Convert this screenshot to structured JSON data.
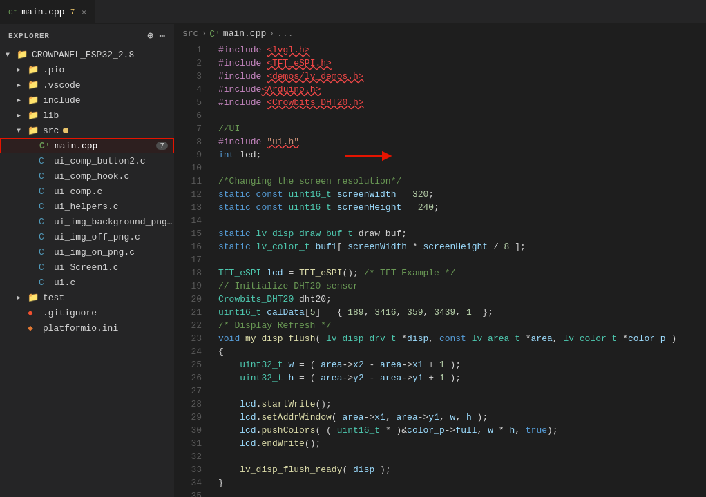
{
  "tabBar": {
    "tabs": [
      {
        "id": "main-cpp",
        "icon": "C++",
        "label": "main.cpp",
        "badge": "7",
        "active": true,
        "closable": true
      }
    ]
  },
  "sidebar": {
    "header": "EXPLORER",
    "tree": [
      {
        "id": "root",
        "label": "CROWPANEL_ESP32_2.8",
        "type": "folder",
        "open": true,
        "level": 0
      },
      {
        "id": "pio",
        "label": ".pio",
        "type": "folder",
        "open": false,
        "level": 1
      },
      {
        "id": "vscode",
        "label": ".vscode",
        "type": "folder",
        "open": false,
        "level": 1
      },
      {
        "id": "include",
        "label": "include",
        "type": "folder",
        "open": false,
        "level": 1
      },
      {
        "id": "lib",
        "label": "lib",
        "type": "folder",
        "open": false,
        "level": 1
      },
      {
        "id": "src",
        "label": "src",
        "type": "folder",
        "open": true,
        "level": 1,
        "modified": true
      },
      {
        "id": "main-cpp",
        "label": "main.cpp",
        "type": "cpp",
        "level": 2,
        "badge": "7",
        "selected": true
      },
      {
        "id": "ui_comp_button2",
        "label": "ui_comp_button2.c",
        "type": "c",
        "level": 2
      },
      {
        "id": "ui_comp_hook",
        "label": "ui_comp_hook.c",
        "type": "c",
        "level": 2
      },
      {
        "id": "ui_comp",
        "label": "ui_comp.c",
        "type": "c",
        "level": 2
      },
      {
        "id": "ui_helpers",
        "label": "ui_helpers.c",
        "type": "c",
        "level": 2
      },
      {
        "id": "ui_img_background_png",
        "label": "ui_img_background_png.c",
        "type": "c",
        "level": 2
      },
      {
        "id": "ui_img_off_png",
        "label": "ui_img_off_png.c",
        "type": "c",
        "level": 2
      },
      {
        "id": "ui_img_on_png",
        "label": "ui_img_on_png.c",
        "type": "c",
        "level": 2
      },
      {
        "id": "ui_Screen1",
        "label": "ui_Screen1.c",
        "type": "c",
        "level": 2
      },
      {
        "id": "ui",
        "label": "ui.c",
        "type": "c",
        "level": 2
      },
      {
        "id": "test",
        "label": "test",
        "type": "folder",
        "open": false,
        "level": 1
      },
      {
        "id": "gitignore",
        "label": ".gitignore",
        "type": "git",
        "level": 1
      },
      {
        "id": "platformio",
        "label": "platformio.ini",
        "type": "ini",
        "level": 1
      }
    ]
  },
  "breadcrumb": {
    "parts": [
      "src",
      ">",
      "main.cpp",
      ">",
      "..."
    ]
  },
  "editor": {
    "filename": "main.cpp",
    "lines": [
      {
        "num": 1,
        "tokens": [
          {
            "t": "#include ",
            "c": "inc"
          },
          {
            "t": "<lvgl.h>",
            "c": "str-red underline-red"
          }
        ]
      },
      {
        "num": 2,
        "tokens": [
          {
            "t": "#include ",
            "c": "inc"
          },
          {
            "t": "<TFT_eSPI.h>",
            "c": "str-red underline-red"
          }
        ]
      },
      {
        "num": 3,
        "tokens": [
          {
            "t": "#include ",
            "c": "inc"
          },
          {
            "t": "<demos/lv_demos.h>",
            "c": "str-red underline-red"
          }
        ]
      },
      {
        "num": 4,
        "tokens": [
          {
            "t": "#include",
            "c": "inc"
          },
          {
            "t": "<Arduino.h>",
            "c": "str-red underline-red"
          }
        ]
      },
      {
        "num": 5,
        "tokens": [
          {
            "t": "#include ",
            "c": "inc"
          },
          {
            "t": "<Crowbits_DHT20.h>",
            "c": "str-red underline-red"
          }
        ]
      },
      {
        "num": 6,
        "tokens": []
      },
      {
        "num": 7,
        "tokens": [
          {
            "t": "//UI",
            "c": "comment"
          }
        ]
      },
      {
        "num": 8,
        "tokens": [
          {
            "t": "#include ",
            "c": "inc"
          },
          {
            "t": "\"ui.h\"",
            "c": "str underline-red"
          }
        ]
      },
      {
        "num": 9,
        "tokens": [
          {
            "t": "int ",
            "c": "kw"
          },
          {
            "t": "led;",
            "c": "plain"
          }
        ]
      },
      {
        "num": 10,
        "tokens": []
      },
      {
        "num": 11,
        "tokens": [
          {
            "t": "/*Changing the screen resolution*/",
            "c": "comment"
          }
        ]
      },
      {
        "num": 12,
        "tokens": [
          {
            "t": "static ",
            "c": "kw"
          },
          {
            "t": "const ",
            "c": "kw"
          },
          {
            "t": "uint16_t ",
            "c": "type"
          },
          {
            "t": "screenWidth",
            "c": "var"
          },
          {
            "t": " = ",
            "c": "plain"
          },
          {
            "t": "320",
            "c": "num"
          },
          {
            "t": ";",
            "c": "punct"
          }
        ]
      },
      {
        "num": 13,
        "tokens": [
          {
            "t": "static ",
            "c": "kw"
          },
          {
            "t": "const ",
            "c": "kw"
          },
          {
            "t": "uint16_t ",
            "c": "type"
          },
          {
            "t": "screenHeight",
            "c": "var"
          },
          {
            "t": " = ",
            "c": "plain"
          },
          {
            "t": "240",
            "c": "num"
          },
          {
            "t": ";",
            "c": "punct"
          }
        ]
      },
      {
        "num": 14,
        "tokens": []
      },
      {
        "num": 15,
        "tokens": [
          {
            "t": "static ",
            "c": "kw"
          },
          {
            "t": "lv_disp_draw_buf_t ",
            "c": "type"
          },
          {
            "t": "draw_buf;",
            "c": "plain"
          }
        ]
      },
      {
        "num": 16,
        "tokens": [
          {
            "t": "static ",
            "c": "kw"
          },
          {
            "t": "lv_color_t ",
            "c": "type"
          },
          {
            "t": "buf1",
            "c": "var"
          },
          {
            "t": "[ ",
            "c": "plain"
          },
          {
            "t": "screenWidth",
            "c": "var"
          },
          {
            "t": " * ",
            "c": "plain"
          },
          {
            "t": "screenHeight",
            "c": "var"
          },
          {
            "t": " / ",
            "c": "plain"
          },
          {
            "t": "8",
            "c": "num"
          },
          {
            "t": " ];",
            "c": "plain"
          }
        ]
      },
      {
        "num": 17,
        "tokens": []
      },
      {
        "num": 18,
        "tokens": [
          {
            "t": "TFT_eSPI ",
            "c": "type"
          },
          {
            "t": "lcd",
            "c": "var"
          },
          {
            "t": " = ",
            "c": "plain"
          },
          {
            "t": "TFT_eSPI",
            "c": "fn"
          },
          {
            "t": "(); ",
            "c": "plain"
          },
          {
            "t": "/* TFT Example */",
            "c": "comment"
          }
        ]
      },
      {
        "num": 19,
        "tokens": [
          {
            "t": "// Initialize DHT20 sensor",
            "c": "comment"
          }
        ]
      },
      {
        "num": 20,
        "tokens": [
          {
            "t": "Crowbits_DHT20 ",
            "c": "type"
          },
          {
            "t": "dht20;",
            "c": "plain"
          }
        ]
      },
      {
        "num": 21,
        "tokens": [
          {
            "t": "uint16_t ",
            "c": "type"
          },
          {
            "t": "calData",
            "c": "var"
          },
          {
            "t": "[",
            "c": "plain"
          },
          {
            "t": "5",
            "c": "num"
          },
          {
            "t": "] = { ",
            "c": "plain"
          },
          {
            "t": "189",
            "c": "num"
          },
          {
            "t": ", ",
            "c": "plain"
          },
          {
            "t": "3416",
            "c": "num"
          },
          {
            "t": ", ",
            "c": "plain"
          },
          {
            "t": "359",
            "c": "num"
          },
          {
            "t": ", ",
            "c": "plain"
          },
          {
            "t": "3439",
            "c": "num"
          },
          {
            "t": ", ",
            "c": "plain"
          },
          {
            "t": "1",
            "c": "num"
          },
          {
            "t": "  };",
            "c": "plain"
          }
        ]
      },
      {
        "num": 22,
        "tokens": [
          {
            "t": "/* Display Refresh */",
            "c": "comment"
          }
        ]
      },
      {
        "num": 23,
        "tokens": [
          {
            "t": "void ",
            "c": "kw"
          },
          {
            "t": "my_disp_flush",
            "c": "fn"
          },
          {
            "t": "( ",
            "c": "plain"
          },
          {
            "t": "lv_disp_drv_t",
            "c": "type"
          },
          {
            "t": " *",
            "c": "plain"
          },
          {
            "t": "disp",
            "c": "var"
          },
          {
            "t": ", ",
            "c": "plain"
          },
          {
            "t": "const ",
            "c": "kw"
          },
          {
            "t": "lv_area_t",
            "c": "type"
          },
          {
            "t": " *",
            "c": "plain"
          },
          {
            "t": "area",
            "c": "var"
          },
          {
            "t": ", ",
            "c": "plain"
          },
          {
            "t": "lv_color_t",
            "c": "type"
          },
          {
            "t": " *",
            "c": "plain"
          },
          {
            "t": "color_p",
            "c": "var"
          },
          {
            "t": " )",
            "c": "plain"
          }
        ]
      },
      {
        "num": 24,
        "tokens": [
          {
            "t": "{",
            "c": "plain"
          }
        ]
      },
      {
        "num": 25,
        "tokens": [
          {
            "t": "    ",
            "c": "plain"
          },
          {
            "t": "uint32_t ",
            "c": "type"
          },
          {
            "t": "w",
            "c": "var"
          },
          {
            "t": " = ( ",
            "c": "plain"
          },
          {
            "t": "area",
            "c": "var"
          },
          {
            "t": "->",
            "c": "plain"
          },
          {
            "t": "x2",
            "c": "var"
          },
          {
            "t": " - ",
            "c": "plain"
          },
          {
            "t": "area",
            "c": "var"
          },
          {
            "t": "->",
            "c": "plain"
          },
          {
            "t": "x1",
            "c": "var"
          },
          {
            "t": " + ",
            "c": "plain"
          },
          {
            "t": "1",
            "c": "num"
          },
          {
            "t": " );",
            "c": "plain"
          }
        ]
      },
      {
        "num": 26,
        "tokens": [
          {
            "t": "    ",
            "c": "plain"
          },
          {
            "t": "uint32_t ",
            "c": "type"
          },
          {
            "t": "h",
            "c": "var"
          },
          {
            "t": " = ( ",
            "c": "plain"
          },
          {
            "t": "area",
            "c": "var"
          },
          {
            "t": "->",
            "c": "plain"
          },
          {
            "t": "y2",
            "c": "var"
          },
          {
            "t": " - ",
            "c": "plain"
          },
          {
            "t": "area",
            "c": "var"
          },
          {
            "t": "->",
            "c": "plain"
          },
          {
            "t": "y1",
            "c": "var"
          },
          {
            "t": " + ",
            "c": "plain"
          },
          {
            "t": "1",
            "c": "num"
          },
          {
            "t": " );",
            "c": "plain"
          }
        ]
      },
      {
        "num": 27,
        "tokens": []
      },
      {
        "num": 28,
        "tokens": [
          {
            "t": "    ",
            "c": "plain"
          },
          {
            "t": "lcd",
            "c": "var"
          },
          {
            "t": ".",
            "c": "plain"
          },
          {
            "t": "startWrite",
            "c": "fn"
          },
          {
            "t": "();",
            "c": "plain"
          }
        ]
      },
      {
        "num": 29,
        "tokens": [
          {
            "t": "    ",
            "c": "plain"
          },
          {
            "t": "lcd",
            "c": "var"
          },
          {
            "t": ".",
            "c": "plain"
          },
          {
            "t": "setAddrWindow",
            "c": "fn"
          },
          {
            "t": "( ",
            "c": "plain"
          },
          {
            "t": "area",
            "c": "var"
          },
          {
            "t": "->",
            "c": "plain"
          },
          {
            "t": "x1",
            "c": "var"
          },
          {
            "t": ", ",
            "c": "plain"
          },
          {
            "t": "area",
            "c": "var"
          },
          {
            "t": "->",
            "c": "plain"
          },
          {
            "t": "y1",
            "c": "var"
          },
          {
            "t": ", ",
            "c": "plain"
          },
          {
            "t": "w",
            "c": "var"
          },
          {
            "t": ", ",
            "c": "plain"
          },
          {
            "t": "h",
            "c": "var"
          },
          {
            "t": " );",
            "c": "plain"
          }
        ]
      },
      {
        "num": 30,
        "tokens": [
          {
            "t": "    ",
            "c": "plain"
          },
          {
            "t": "lcd",
            "c": "var"
          },
          {
            "t": ".",
            "c": "plain"
          },
          {
            "t": "pushColors",
            "c": "fn"
          },
          {
            "t": "( ( ",
            "c": "plain"
          },
          {
            "t": "uint16_t",
            "c": "type"
          },
          {
            "t": " * )&",
            "c": "plain"
          },
          {
            "t": "color_p",
            "c": "var"
          },
          {
            "t": "->",
            "c": "plain"
          },
          {
            "t": "full",
            "c": "var"
          },
          {
            "t": ", ",
            "c": "plain"
          },
          {
            "t": "w",
            "c": "var"
          },
          {
            "t": " * ",
            "c": "plain"
          },
          {
            "t": "h",
            "c": "var"
          },
          {
            "t": ", ",
            "c": "plain"
          },
          {
            "t": "true",
            "c": "kw"
          },
          {
            "t": ");",
            "c": "plain"
          }
        ]
      },
      {
        "num": 31,
        "tokens": [
          {
            "t": "    ",
            "c": "plain"
          },
          {
            "t": "lcd",
            "c": "var"
          },
          {
            "t": ".",
            "c": "plain"
          },
          {
            "t": "endWrite",
            "c": "fn"
          },
          {
            "t": "();",
            "c": "plain"
          }
        ]
      },
      {
        "num": 32,
        "tokens": []
      },
      {
        "num": 33,
        "tokens": [
          {
            "t": "    ",
            "c": "plain"
          },
          {
            "t": "lv_disp_flush_ready",
            "c": "fn"
          },
          {
            "t": "( ",
            "c": "plain"
          },
          {
            "t": "disp",
            "c": "var"
          },
          {
            "t": " );",
            "c": "plain"
          }
        ]
      },
      {
        "num": 34,
        "tokens": [
          {
            "t": "}",
            "c": "plain"
          }
        ]
      },
      {
        "num": 35,
        "tokens": []
      }
    ]
  }
}
